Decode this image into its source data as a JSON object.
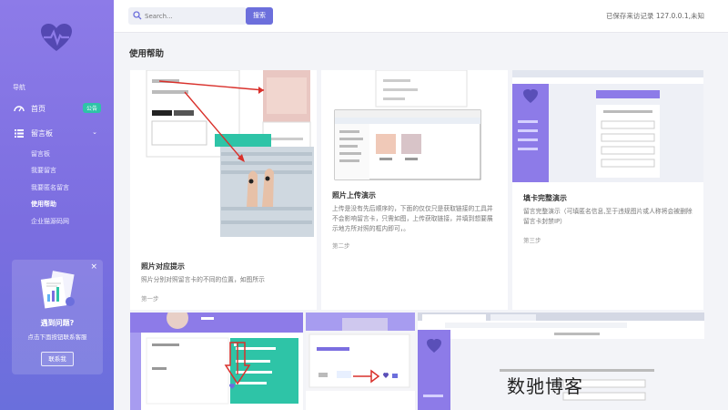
{
  "sidebar": {
    "nav_header": "导航",
    "home": {
      "label": "首页",
      "badge": "公告"
    },
    "board": {
      "label": "留言板"
    },
    "sub_items": [
      "留言板",
      "我要留言",
      "我要匿名留言",
      "使用帮助",
      "企业猫源码网"
    ],
    "active_sub": "使用帮助",
    "help_card": {
      "title": "遇到问题?",
      "subtitle": "点击下面按钮联系客服",
      "button": "联系我",
      "close": "×"
    }
  },
  "topbar": {
    "search_placeholder": "Search...",
    "search_button": "搜索",
    "status": "已保存来访记录 127.0.0.1,未知"
  },
  "page_title": "使用帮助",
  "cards": [
    {
      "title": "照片对应提示",
      "desc": "照片分别对照留言卡的不同的位置，如图所示",
      "step": "第一步"
    },
    {
      "title": "照片上传演示",
      "desc": "上传是没有先后顺序的，下面的仅仅只是获取链接的工具并不会影响留言卡，只需如图，上传获取链接，并填到想要展示地方所对照的框内即可，。",
      "step": "第二步"
    },
    {
      "title": "填卡完整演示",
      "desc": "留言完整演示（可填匿名信息,至于违规图片或人称将会被删除留言卡封禁IP）",
      "step": "第三步"
    }
  ],
  "watermark": "数驰博客",
  "colors": {
    "sidebar_top": "#8d7be8",
    "sidebar_bottom": "#6a6fdc",
    "accent": "#6c6fdc",
    "badge": "#2ec4a7"
  }
}
